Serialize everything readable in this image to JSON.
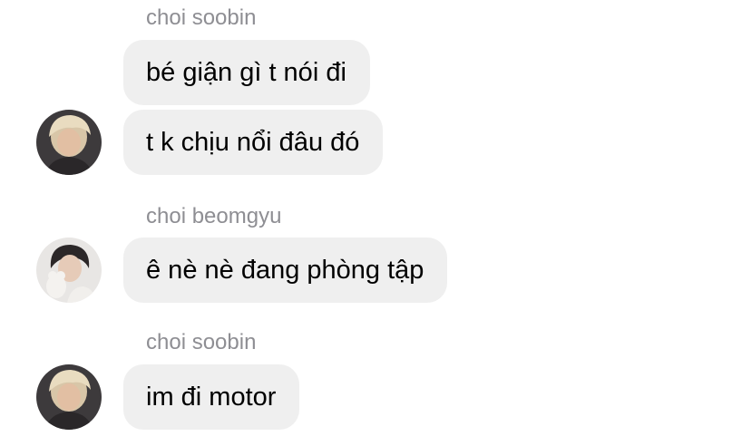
{
  "messages": [
    {
      "sender": "choi soobin",
      "bubbles": [
        "bé giận gì t nói đi",
        "t k chịu nổi đâu đó"
      ],
      "avatar": "soobin-avatar"
    },
    {
      "sender": "choi beomgyu",
      "bubbles": [
        "ê nè nè đang phòng tập"
      ],
      "avatar": "beomgyu-avatar"
    },
    {
      "sender": "choi soobin",
      "bubbles": [
        "im đi motor"
      ],
      "avatar": "soobin-avatar"
    }
  ],
  "colors": {
    "bubble_bg": "#efefef",
    "sender_text": "#8e8e93",
    "message_text": "#000000"
  }
}
